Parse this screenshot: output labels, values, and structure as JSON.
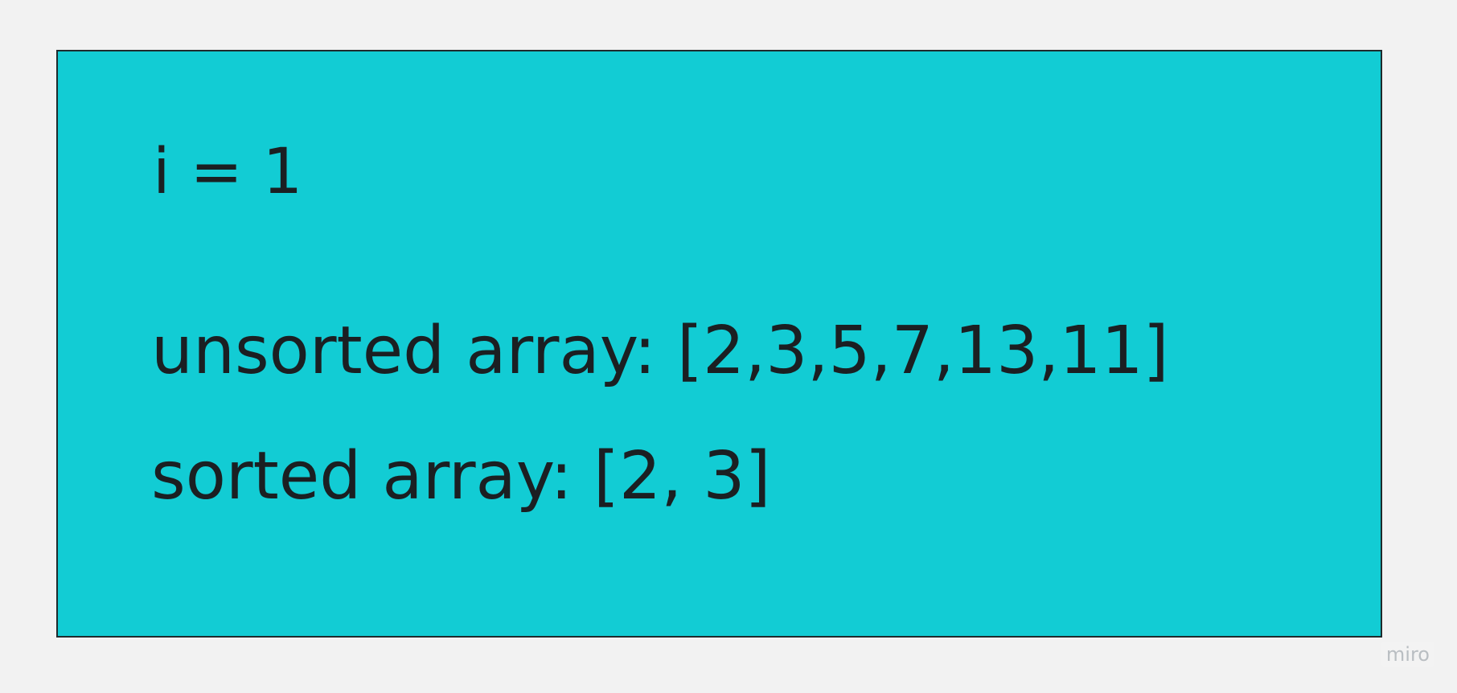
{
  "card": {
    "background_color": "#12ccd4",
    "border_color": "#1f2a2c",
    "text_color": "#1b1f22"
  },
  "content": {
    "i_line": "i = 1",
    "unsorted_line": "unsorted array: [2,3,5,7,13,11]",
    "sorted_line": "sorted array: [2, 3]"
  },
  "watermark": {
    "text": "miro"
  },
  "page": {
    "background_color": "#f2f2f2"
  }
}
